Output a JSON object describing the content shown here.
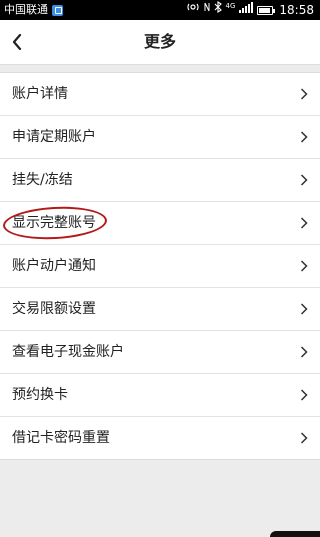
{
  "status_bar": {
    "carrier": "中国联通",
    "network_badge": "4G",
    "time": "18:58",
    "battery_level": 0.85
  },
  "header": {
    "title": "更多"
  },
  "menu": {
    "items": [
      {
        "label": "账户详情"
      },
      {
        "label": "申请定期账户"
      },
      {
        "label": "挂失/冻结"
      },
      {
        "label": "显示完整账号"
      },
      {
        "label": "账户动户通知"
      },
      {
        "label": "交易限额设置"
      },
      {
        "label": "查看电子现金账户"
      },
      {
        "label": "预约换卡"
      },
      {
        "label": "借记卡密码重置"
      }
    ]
  },
  "colors": {
    "highlight_ring": "#b21a1a",
    "background": "#ececec"
  }
}
